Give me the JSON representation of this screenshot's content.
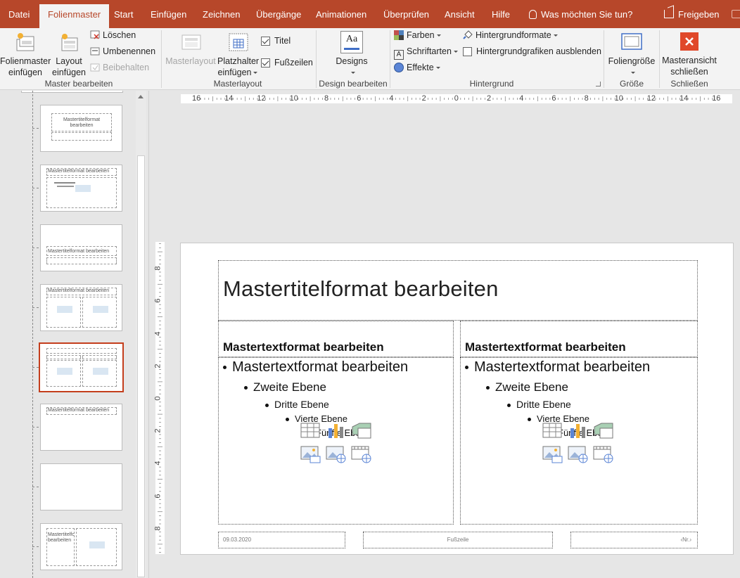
{
  "tabs": [
    {
      "label": "Datei",
      "active": false
    },
    {
      "label": "Folienmaster",
      "active": true
    },
    {
      "label": "Start",
      "active": false
    },
    {
      "label": "Einfügen",
      "active": false
    },
    {
      "label": "Zeichnen",
      "active": false
    },
    {
      "label": "Übergänge",
      "active": false
    },
    {
      "label": "Animationen",
      "active": false
    },
    {
      "label": "Überprüfen",
      "active": false
    },
    {
      "label": "Ansicht",
      "active": false
    },
    {
      "label": "Hilfe",
      "active": false
    }
  ],
  "tell_me": "Was möchten Sie tun?",
  "share": "Freigeben",
  "colors": {
    "accent": "#b7472a",
    "selection": "#c43e1c",
    "close_icon": "#e0482a"
  },
  "ribbon": {
    "master_edit": {
      "insert_master_l1": "Folienmaster",
      "insert_master_l2": "einfügen",
      "insert_layout_l1": "Layout",
      "insert_layout_l2": "einfügen",
      "delete": "Löschen",
      "rename": "Umbenennen",
      "preserve": "Beibehalten",
      "label": "Master bearbeiten"
    },
    "master_layout": {
      "master_layout": "Masterlayout",
      "placeholder_l1": "Platzhalter",
      "placeholder_l2": "einfügen",
      "title_chk": "Titel",
      "footer_chk": "Fußzeilen",
      "label": "Masterlayout"
    },
    "design_edit": {
      "designs": "Designs",
      "label": "Design bearbeiten",
      "design_icon_text": "Aa"
    },
    "background": {
      "colors": "Farben",
      "fonts": "Schriftarten",
      "effects": "Effekte",
      "bg_formats": "Hintergrundformate",
      "hide_bg": "Hintergrundgrafiken ausblenden",
      "label": "Hintergrund"
    },
    "size": {
      "slide_size": "Foliengröße",
      "label": "Größe"
    },
    "close": {
      "close_l1": "Masteransicht",
      "close_l2": "schließen",
      "label": "Schließen"
    }
  },
  "thumbs": {
    "t1_title": "Mastertitelformat bearbeiten",
    "t2_title": "Mastertitelformat bearbeiten",
    "t3_title": "Mastertitelformat bearbeiten",
    "t4_title": "Mastertitelformat bearbeiten",
    "t6_title": "Mastertitelformat bearbeiten",
    "t8_title": "Mastertitelformat bearbeiten"
  },
  "hruler_labels": [
    "16",
    "14",
    "12",
    "10",
    "8",
    "6",
    "4",
    "2",
    "0",
    "2",
    "4",
    "6",
    "8",
    "10",
    "12",
    "14",
    "16"
  ],
  "vruler_labels": [
    "8",
    "6",
    "4",
    "2",
    "0",
    "2",
    "4",
    "6",
    "8"
  ],
  "slide": {
    "title": "Mastertitelformat bearbeiten",
    "left": {
      "header": "Mastertextformat bearbeiten",
      "l1": "Mastertextformat bearbeiten",
      "l2": "Zweite Ebene",
      "l3": "Dritte Ebene",
      "l4": "Vierte Ebene",
      "l5": "Fünfte Ebene"
    },
    "right": {
      "header": "Mastertextformat bearbeiten",
      "l1": "Mastertextformat bearbeiten",
      "l2": "Zweite Ebene",
      "l3": "Dritte Ebene",
      "l4": "Vierte Ebene",
      "l5": "Fünfte Ebene"
    },
    "footer_date": "09.03.2020",
    "footer_text": "Fußzeile",
    "footer_num": "‹Nr.›"
  }
}
